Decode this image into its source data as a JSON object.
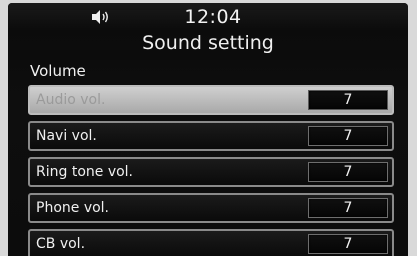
{
  "status": {
    "time": "12:04",
    "icon": "speaker-volume-icon"
  },
  "page": {
    "title": "Sound setting",
    "section_label": "Volume"
  },
  "items": [
    {
      "label": "Audio vol.",
      "value": "7",
      "selected": true
    },
    {
      "label": "Navi vol.",
      "value": "7",
      "selected": false
    },
    {
      "label": "Ring tone vol.",
      "value": "7",
      "selected": false
    },
    {
      "label": "Phone vol.",
      "value": "7",
      "selected": false
    },
    {
      "label": "CB vol.",
      "value": "7",
      "selected": false
    }
  ]
}
